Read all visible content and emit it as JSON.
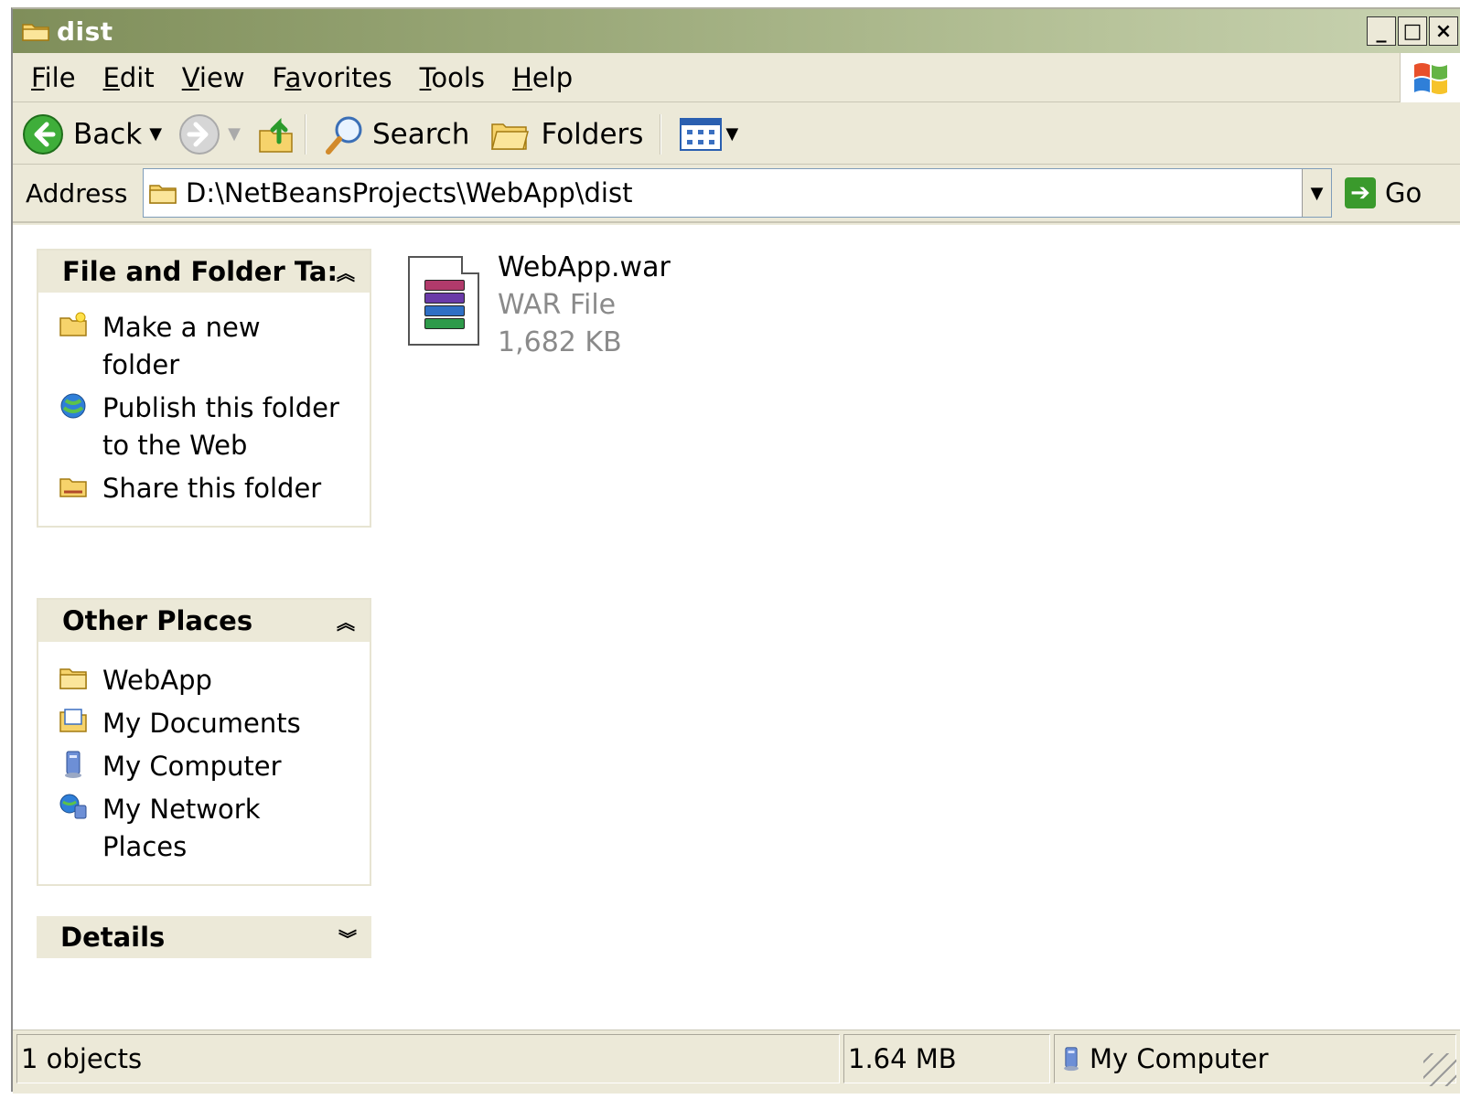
{
  "window": {
    "title": "dist"
  },
  "menu": {
    "items": [
      {
        "label": "File",
        "accel": "F"
      },
      {
        "label": "Edit",
        "accel": "E"
      },
      {
        "label": "View",
        "accel": "V"
      },
      {
        "label": "Favorites",
        "accel": "a"
      },
      {
        "label": "Tools",
        "accel": "T"
      },
      {
        "label": "Help",
        "accel": "H"
      }
    ]
  },
  "toolbar": {
    "back_label": "Back",
    "search_label": "Search",
    "folders_label": "Folders"
  },
  "address": {
    "label": "Address",
    "path": "D:\\NetBeansProjects\\WebApp\\dist",
    "go_label": "Go"
  },
  "tasks_panel": {
    "title": "File and Folder Ta:",
    "items": [
      {
        "label": "Make a new folder",
        "icon": "new-folder-icon"
      },
      {
        "label": "Publish this folder to the Web",
        "icon": "publish-web-icon"
      },
      {
        "label": "Share this folder",
        "icon": "share-folder-icon"
      }
    ]
  },
  "places_panel": {
    "title": "Other Places",
    "items": [
      {
        "label": "WebApp",
        "icon": "folder-icon"
      },
      {
        "label": "My Documents",
        "icon": "my-documents-icon"
      },
      {
        "label": "My Computer",
        "icon": "my-computer-icon"
      },
      {
        "label": "My Network Places",
        "icon": "network-places-icon"
      }
    ]
  },
  "details_panel": {
    "title": "Details"
  },
  "file": {
    "name": "WebApp.war",
    "type": "WAR File",
    "size": "1,682 KB"
  },
  "status": {
    "objects": "1 objects",
    "size": "1.64 MB",
    "location": "My Computer"
  },
  "colors": {
    "titlebar_start": "#7f8e5a",
    "chrome": "#ece9d8",
    "go_green": "#3a9a2c"
  }
}
